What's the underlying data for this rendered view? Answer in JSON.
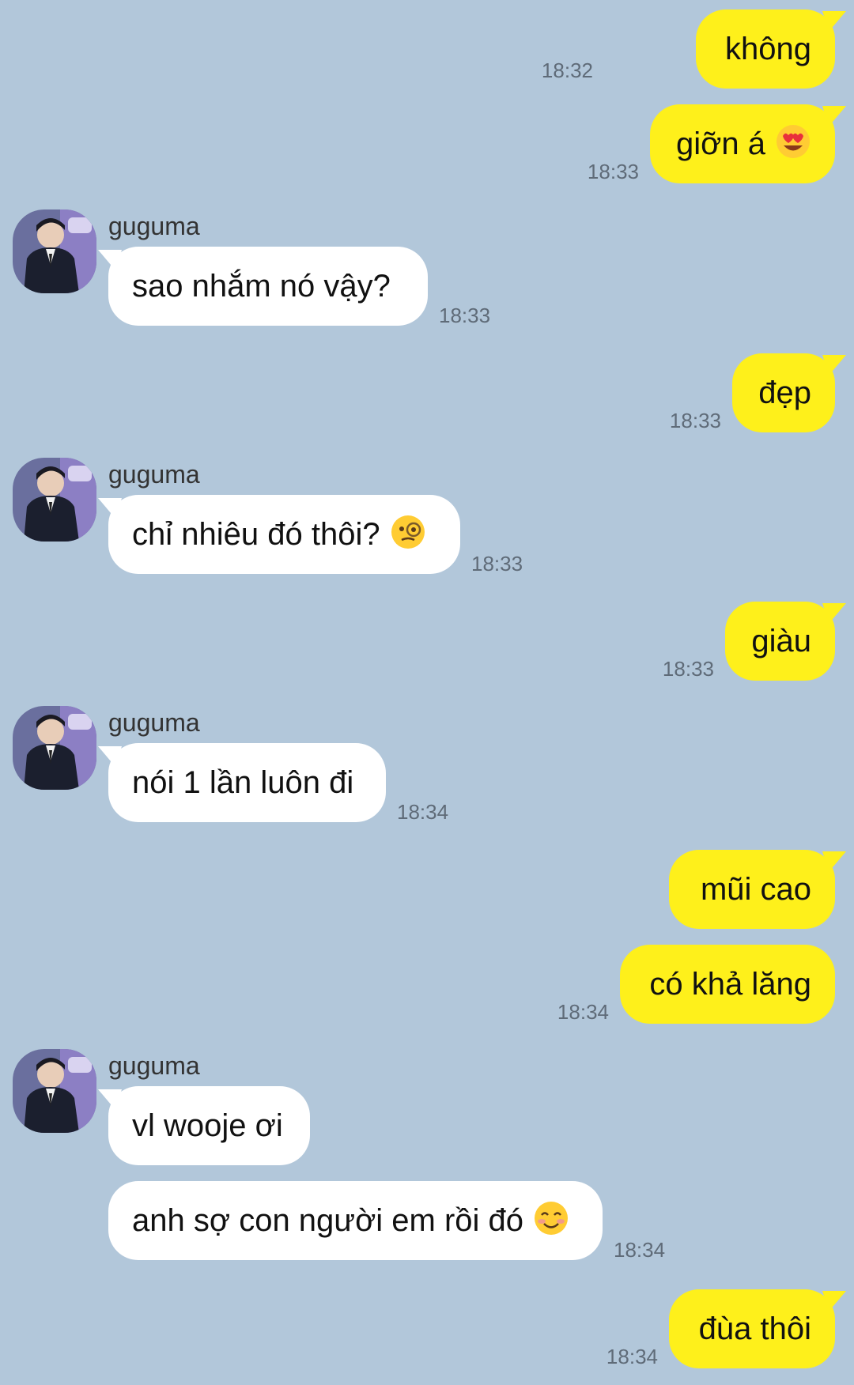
{
  "messages": [
    {
      "text": "không",
      "time": "18:32"
    },
    {
      "text": "giỡn á",
      "emoji": "heart-eyes-emoji",
      "time": "18:33"
    },
    {
      "sender": "guguma",
      "text": "sao nhắm nó vậy?",
      "time": "18:33"
    },
    {
      "text": "đẹp",
      "time": "18:33"
    },
    {
      "sender": "guguma",
      "text": "chỉ nhiêu đó thôi?",
      "emoji": "monocle-emoji",
      "time": "18:33"
    },
    {
      "text": "giàu",
      "time": "18:33"
    },
    {
      "sender": "guguma",
      "text": "nói 1 lần luôn đi",
      "time": "18:34"
    },
    {
      "text": "mũi cao"
    },
    {
      "text": "có khả lăng",
      "time": "18:34"
    },
    {
      "sender": "guguma",
      "text": "vl wooje ơi"
    },
    {
      "text": "anh sợ con người em rồi đó",
      "emoji": "smiling-blush-emoji",
      "time": "18:34"
    },
    {
      "text": "đùa thôi",
      "time": "18:34"
    }
  ],
  "colors": {
    "background": "#b2c7da",
    "sent_bubble": "#fef01b",
    "received_bubble": "#ffffff",
    "timestamp": "#5f6b78"
  }
}
